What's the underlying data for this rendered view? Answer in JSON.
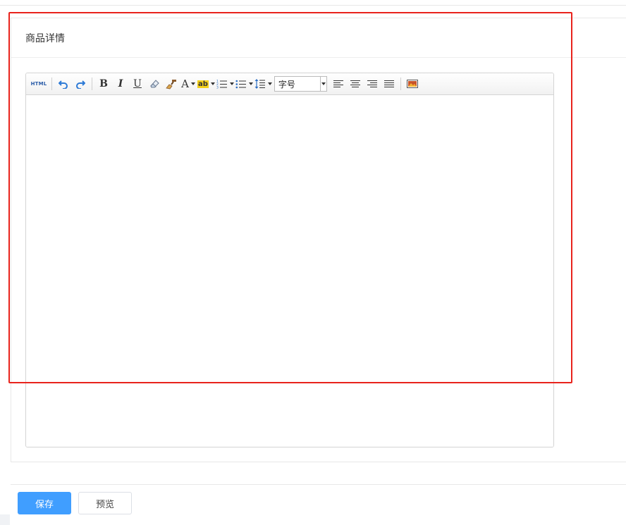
{
  "section": {
    "title": "商品详情"
  },
  "toolbar": {
    "html_label": "HTML",
    "bold_label": "B",
    "italic_label": "I",
    "underline_label": "U",
    "font_color_label": "A",
    "highlight_label": "ab",
    "font_size_value": "字号"
  },
  "actions": {
    "save_label": "保存",
    "preview_label": "预览"
  },
  "colors": {
    "primary": "#409eff",
    "highlight_box": "#e8231c"
  }
}
